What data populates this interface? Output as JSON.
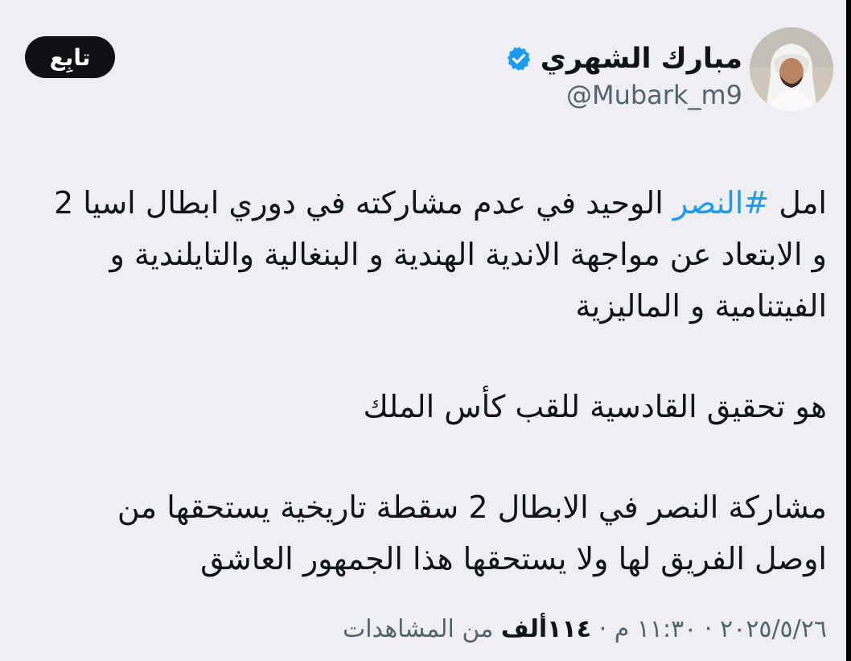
{
  "author": {
    "display_name": "مبارك الشهري",
    "handle": "@Mubark_m9",
    "verified_icon": "verified-badge-icon",
    "avatar": "avatar-photo"
  },
  "follow_button": {
    "label": "تابِع"
  },
  "tweet": {
    "line1_prefix": "امل ",
    "hashtag": "#النصر",
    "line1_suffix": " الوحيد في عدم مشاركته في دوري ابطال اسيا 2",
    "line2": "و الابتعاد عن مواجهة الاندية الهندية و البنغالية والتايلندية و",
    "line3": "الفيتنامية و  الماليزية",
    "line4": "هو تحقيق القادسية للقب كأس الملك",
    "line5": "مشاركة النصر في الابطال 2  سقطة تاريخية يستحقها من",
    "line6": "اوصل الفريق لها  ولا يستحقها هذا الجمهور العاشق"
  },
  "meta": {
    "date": "٢٠٢٥/٥/٢٦",
    "separator": " · ",
    "time": "١١:٣٠ م",
    "views_count": "١١٤ألف",
    "views_label": " من المشاهدات"
  },
  "colors": {
    "background": "#efeef2",
    "hashtag": "#1d9bf0",
    "verified": "#1d9bf0",
    "follow_button": "#101014",
    "secondary_text": "#536471"
  }
}
